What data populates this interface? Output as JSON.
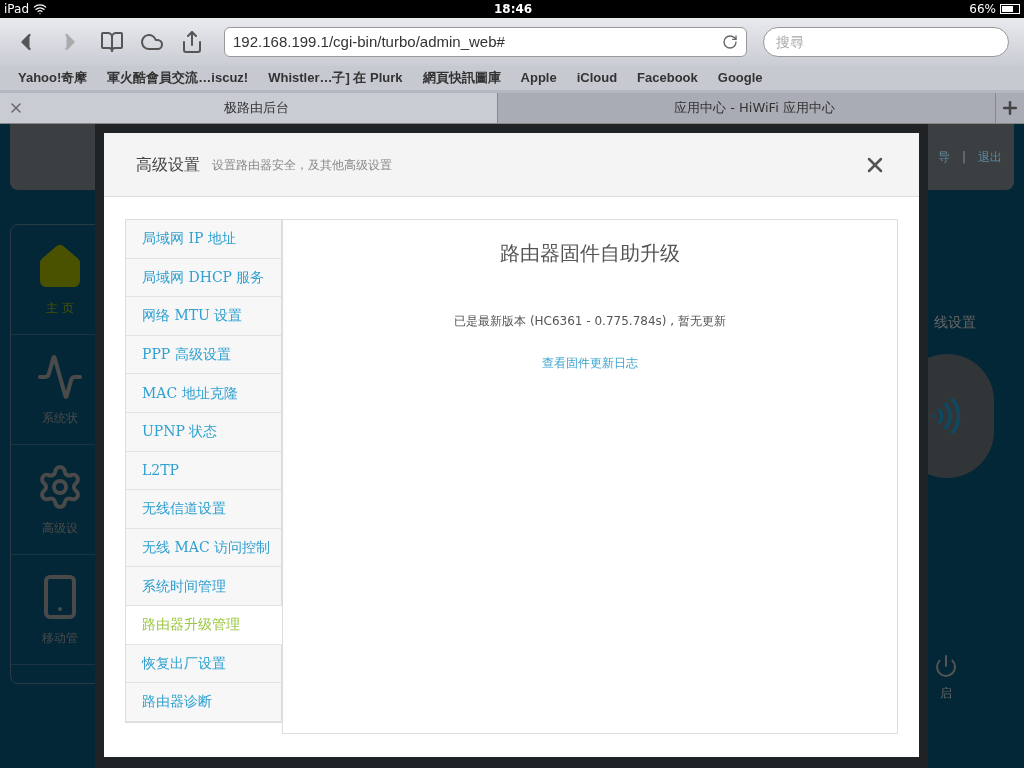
{
  "status_bar": {
    "device": "iPad",
    "time": "18:46",
    "battery": "66%"
  },
  "browser": {
    "url": "192.168.199.1/cgi-bin/turbo/admin_web#",
    "search_placeholder": "搜尋",
    "bookmarks": [
      "Yahoo!奇摩",
      "軍火酷會員交流…iscuz!",
      "Whistler…子] 在 Plurk",
      "網頁快訊圖庫",
      "Apple",
      "iCloud",
      "Facebook",
      "Google"
    ],
    "tabs": [
      {
        "title": "极路由后台",
        "selected": true
      },
      {
        "title": "应用中心 - HiWiFi 应用中心",
        "selected": false
      }
    ]
  },
  "page": {
    "nav": [
      {
        "label": "主 页",
        "kind": "home",
        "selected": true
      },
      {
        "label": "系统状",
        "kind": "status",
        "selected": false
      },
      {
        "label": "高级设",
        "kind": "gear",
        "selected": false
      },
      {
        "label": "移动管",
        "kind": "mobile",
        "selected": false
      }
    ],
    "header_links": [
      "导",
      "退出"
    ],
    "header_separator": "|",
    "wireless_label": "线设置",
    "restart_label": "启"
  },
  "modal": {
    "title": "高级设置",
    "subtitle": "设置路由器安全，及其他高级设置",
    "menu": [
      {
        "label": "局域网 IP 地址",
        "selected": false
      },
      {
        "label": "局域网 DHCP 服务",
        "selected": false
      },
      {
        "label": "网络 MTU 设置",
        "selected": false
      },
      {
        "label": "PPP 高级设置",
        "selected": false
      },
      {
        "label": "MAC 地址克隆",
        "selected": false
      },
      {
        "label": "UPNP 状态",
        "selected": false
      },
      {
        "label": "L2TP",
        "selected": false
      },
      {
        "label": "无线信道设置",
        "selected": false
      },
      {
        "label": "无线 MAC 访问控制",
        "selected": false
      },
      {
        "label": "系统时间管理",
        "selected": false
      },
      {
        "label": "路由器升级管理",
        "selected": true
      },
      {
        "label": "恢复出厂设置",
        "selected": false
      },
      {
        "label": "路由器诊断",
        "selected": false
      }
    ],
    "heading": "路由器固件自助升级",
    "status": "已是最新版本 (HC6361 - 0.775.784s) , 暂无更新",
    "link": "查看固件更新日志"
  }
}
